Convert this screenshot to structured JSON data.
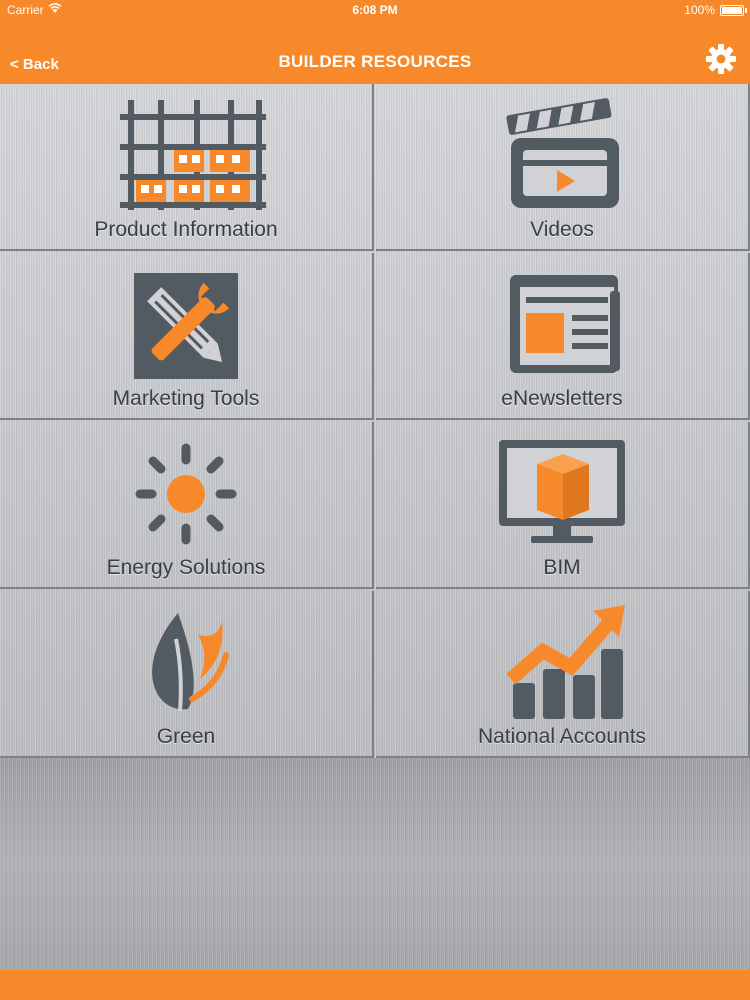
{
  "status_bar": {
    "carrier": "Carrier",
    "time": "6:08 PM",
    "battery": "100%"
  },
  "nav": {
    "back_label": "< Back",
    "title": "BUILDER RESOURCES",
    "settings_icon": "gear-icon"
  },
  "colors": {
    "accent": "#f7892b",
    "icon_dark": "#525a62"
  },
  "tiles": [
    {
      "label": "Product Information",
      "icon": "scaffold-icon"
    },
    {
      "label": "Videos",
      "icon": "clapperboard-icon"
    },
    {
      "label": "Marketing Tools",
      "icon": "tools-icon"
    },
    {
      "label": "eNewsletters",
      "icon": "newspaper-icon"
    },
    {
      "label": "Energy Solutions",
      "icon": "sun-icon"
    },
    {
      "label": "BIM",
      "icon": "monitor-cube-icon"
    },
    {
      "label": "Green",
      "icon": "leaf-icon"
    },
    {
      "label": "National Accounts",
      "icon": "growth-chart-icon"
    }
  ]
}
